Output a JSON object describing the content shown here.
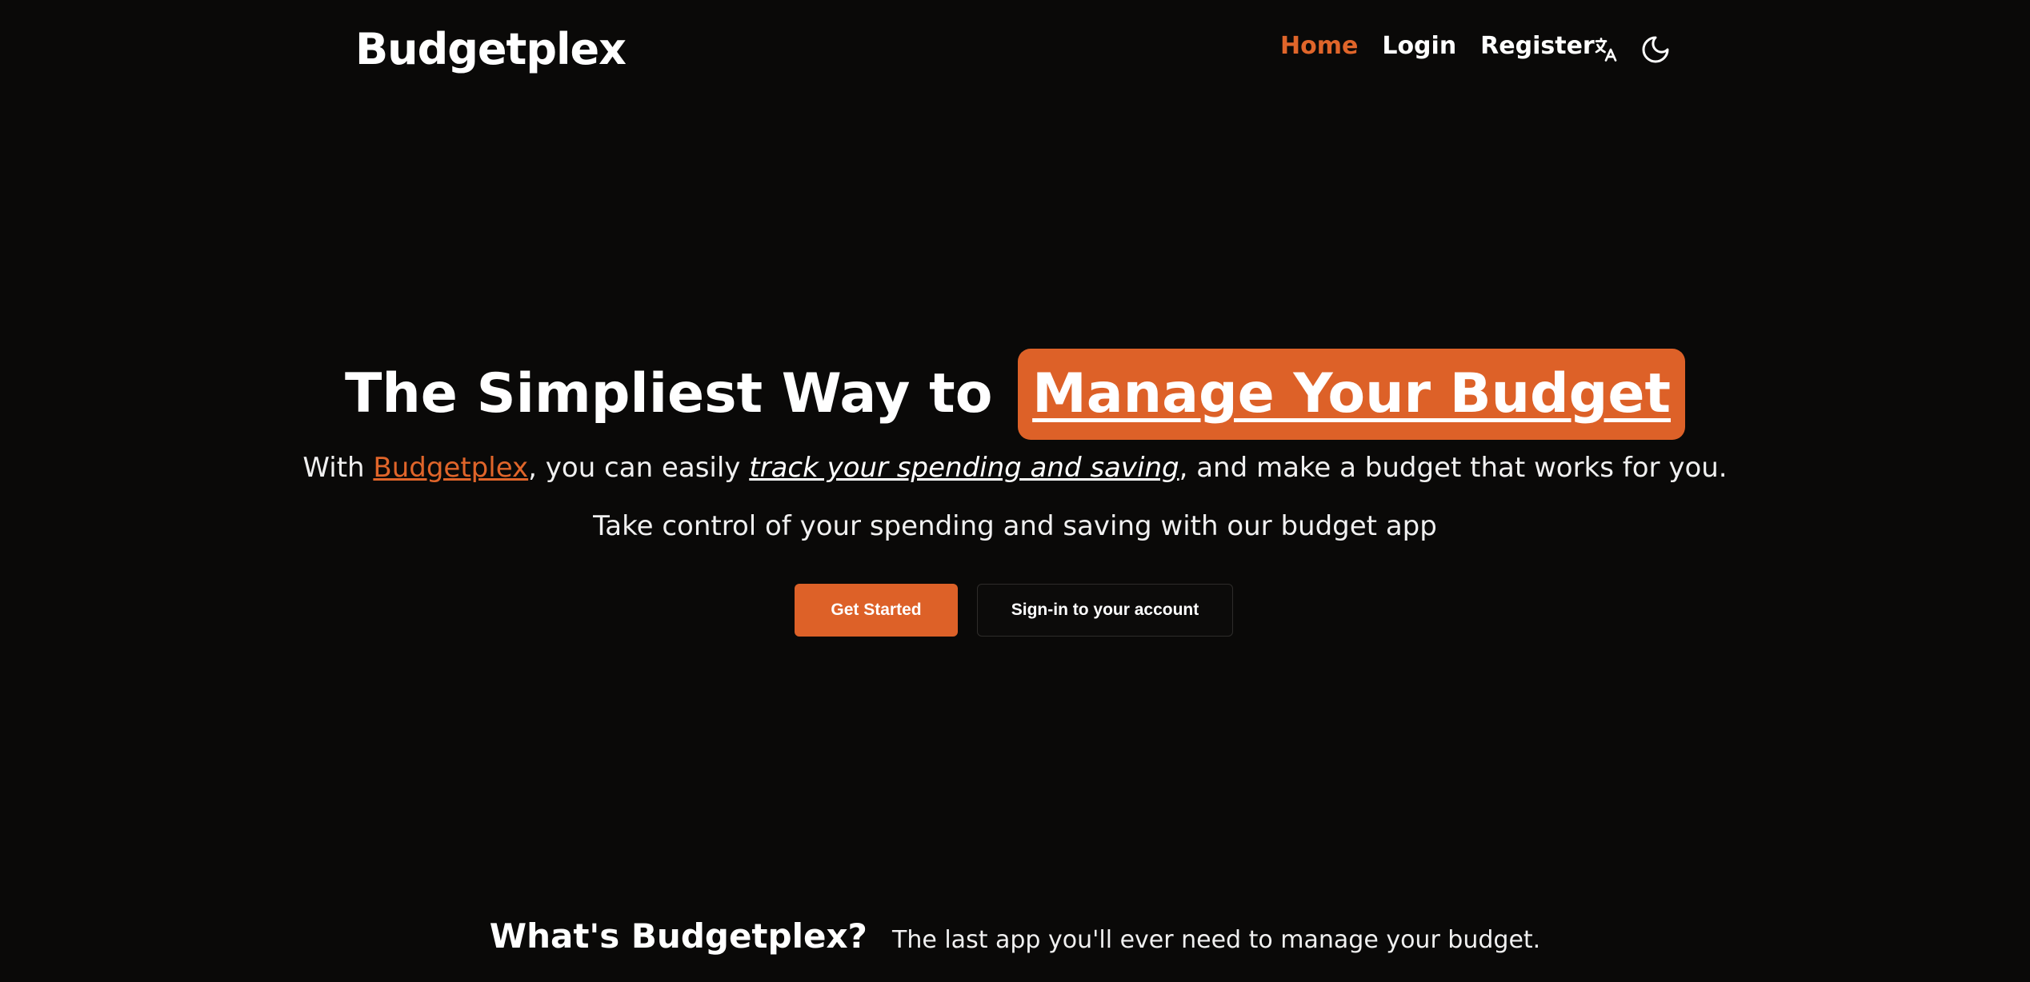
{
  "header": {
    "logo": "Budgetplex",
    "nav": [
      {
        "label": "Home",
        "active": true
      },
      {
        "label": "Login",
        "active": false
      },
      {
        "label": "Register",
        "active": false
      }
    ],
    "icons": [
      "translate-icon",
      "moon-icon"
    ]
  },
  "hero": {
    "title_prefix": "The Simpliest Way to",
    "title_highlight": "Manage Your Budget",
    "sub_with": "With ",
    "sub_brand": "Budgetplex",
    "sub_mid": ", you can easily ",
    "sub_emph": "track your spending and saving",
    "sub_end": ", and make a budget that works for you.",
    "sub2": "Take control of your spending and saving with our budget app",
    "primary_cta": "Get Started",
    "secondary_cta": "Sign-in to your account"
  },
  "whats": {
    "title": "What's Budgetplex?",
    "description": "The last app you'll ever need to manage your budget."
  },
  "colors": {
    "background": "#0a0908",
    "accent": "#dd6128",
    "text": "#ffffff"
  }
}
